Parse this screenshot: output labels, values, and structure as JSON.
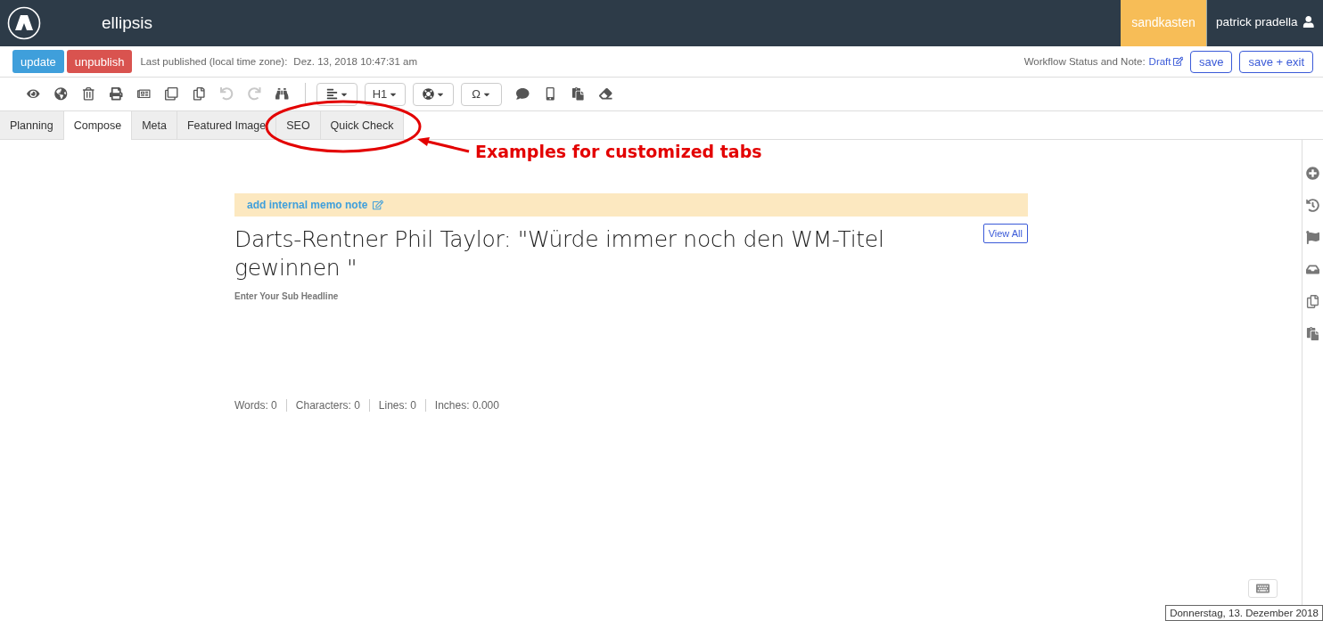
{
  "header": {
    "app_name": "ellipsis",
    "environment": "sandkasten",
    "user": "patrick pradella"
  },
  "actionbar": {
    "buttons": [
      {
        "label": "update",
        "kind": "primary"
      },
      {
        "label": "unpublish",
        "kind": "danger"
      }
    ],
    "last_published_label": "Last published (local time zone):",
    "last_published_date": "Dez. 13, 2018 10:47:31 am",
    "workflow_label": "Workflow Status and Note:",
    "workflow_status": "Draft",
    "right_buttons": [
      "save",
      "save + exit"
    ]
  },
  "toolbar": {
    "tools": [
      {
        "disabled": false
      },
      {
        "disabled": false
      },
      {
        "disabled": false
      },
      {
        "disabled": false
      },
      {
        "disabled": false
      },
      {
        "disabled": false
      },
      {
        "disabled": false
      },
      {
        "disabled": true
      },
      {
        "disabled": true
      },
      {
        "disabled": false
      }
    ],
    "dropdowns": [
      {
        "kind": "icon"
      },
      {
        "kind": "text",
        "label": "H1"
      },
      {
        "kind": "icon"
      },
      {
        "kind": "text",
        "label": "Ω"
      }
    ],
    "tools_after": [
      {
        "disabled": false
      },
      {
        "disabled": false
      },
      {
        "disabled": false
      },
      {
        "disabled": false
      }
    ]
  },
  "tabs": [
    {
      "label": "Planning",
      "selected": false
    },
    {
      "label": "Compose",
      "selected": true
    },
    {
      "label": "Meta",
      "selected": false
    },
    {
      "label": "Featured Image",
      "selected": false
    },
    {
      "label": "SEO",
      "selected": false
    },
    {
      "label": "Quick Check",
      "selected": false
    }
  ],
  "annotation": {
    "text": "Examples for customized tabs"
  },
  "editor": {
    "memo_link": "add internal memo note",
    "headline": "Darts-Rentner Phil Taylor: \"Würde immer noch den WM-Titel gewinnen \"",
    "view_all": "View All",
    "subheadline_placeholder": "Enter Your Sub Headline",
    "stats": [
      "Words: 0",
      "Characters: 0",
      "Lines: 0",
      "Inches: 0.000"
    ]
  },
  "footer": {
    "date_tooltip": "Donnerstag, 13. Dezember 2018"
  }
}
